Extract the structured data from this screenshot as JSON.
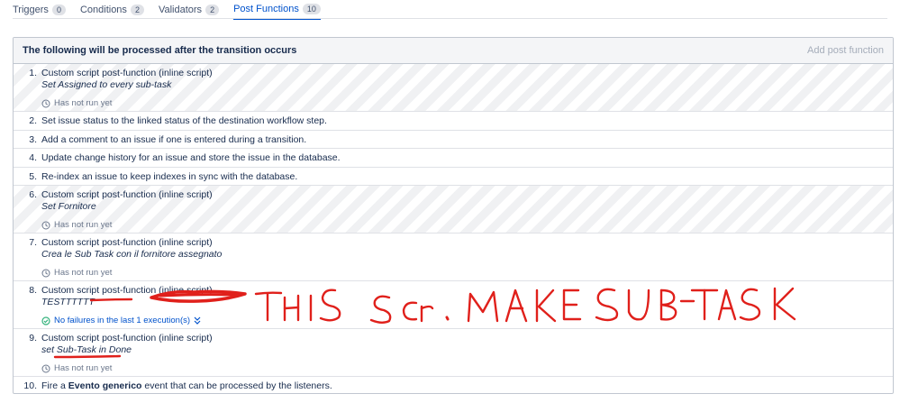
{
  "tabs": [
    {
      "label": "Triggers",
      "count": "0"
    },
    {
      "label": "Conditions",
      "count": "2"
    },
    {
      "label": "Validators",
      "count": "2"
    },
    {
      "label": "Post Functions",
      "count": "10"
    }
  ],
  "panel": {
    "title": "The following will be processed after the transition occurs",
    "action": "Add post function"
  },
  "rows": [
    {
      "num": "1.",
      "title": "Custom script post-function (inline script)",
      "subtitle": "Set Assigned to every sub-task",
      "status": "Has not run yet"
    },
    {
      "num": "2.",
      "text": "Set issue status to the linked status of the destination workflow step."
    },
    {
      "num": "3.",
      "text": "Add a comment to an issue if one is entered during a transition."
    },
    {
      "num": "4.",
      "text": "Update change history for an issue and store the issue in the database."
    },
    {
      "num": "5.",
      "text": "Re-index an issue to keep indexes in sync with the database."
    },
    {
      "num": "6.",
      "title": "Custom script post-function (inline script)",
      "subtitle": "Set Fornitore",
      "status": "Has not run yet"
    },
    {
      "num": "7.",
      "title": "Custom script post-function (inline script)",
      "subtitle": "Crea le Sub Task con il fornitore assegnato",
      "status": "Has not run yet"
    },
    {
      "num": "8.",
      "title": "Custom script post-function (inline script)",
      "subtitle": "TESTTTTTT",
      "status": "No failures in the last 1 execution(s)"
    },
    {
      "num": "9.",
      "title": "Custom script post-function (inline script)",
      "subtitle": "set Sub-Task in Done",
      "status": "Has not run yet"
    },
    {
      "num": "10.",
      "text_before": "Fire a",
      "text_bold": "Evento generico",
      "text_after": "event that can be processed by the listeners."
    }
  ],
  "annotation": {
    "text": "THIS SCR. MAKE SUB-TASK",
    "color": "#e0201b"
  },
  "colors": {
    "accent": "#0052cc",
    "success": "#36b37e",
    "muted": "#6b778c"
  },
  "icons": {
    "clock": "clock-icon",
    "check": "check-circle-icon",
    "expand": "double-chevron-down-icon"
  }
}
